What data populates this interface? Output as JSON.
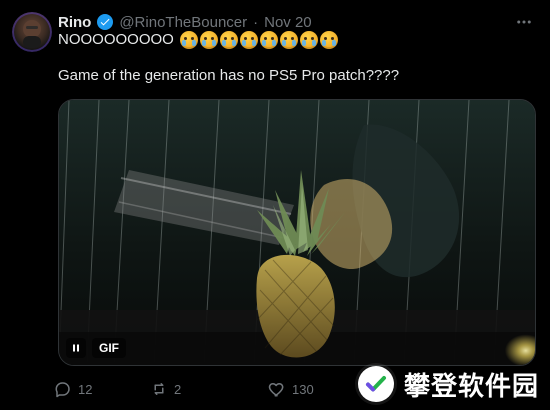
{
  "post": {
    "author": {
      "name": "Rino",
      "handle": "@RinoTheBouncer",
      "separator": "·",
      "date": "Nov 20"
    },
    "text_line_1": "NOOOOOOOOO",
    "emoji_repeat": 8,
    "text_line_2": "Game of the generation has no PS5 Pro patch????",
    "media": {
      "gif_label": "GIF"
    },
    "stats": {
      "replies": "12",
      "reposts": "2",
      "likes": "130"
    }
  },
  "watermark": {
    "text": "攀登软件园"
  },
  "icons": {
    "more": "more-horizontal-icon",
    "verified": "verified-badge-icon",
    "reply": "reply-icon",
    "repost": "repost-icon",
    "like": "heart-icon",
    "pause": "pause-icon"
  },
  "colors": {
    "accent": "#1d9bf0",
    "muted": "#71767b",
    "text": "#e7e9ea",
    "background": "#000000"
  }
}
